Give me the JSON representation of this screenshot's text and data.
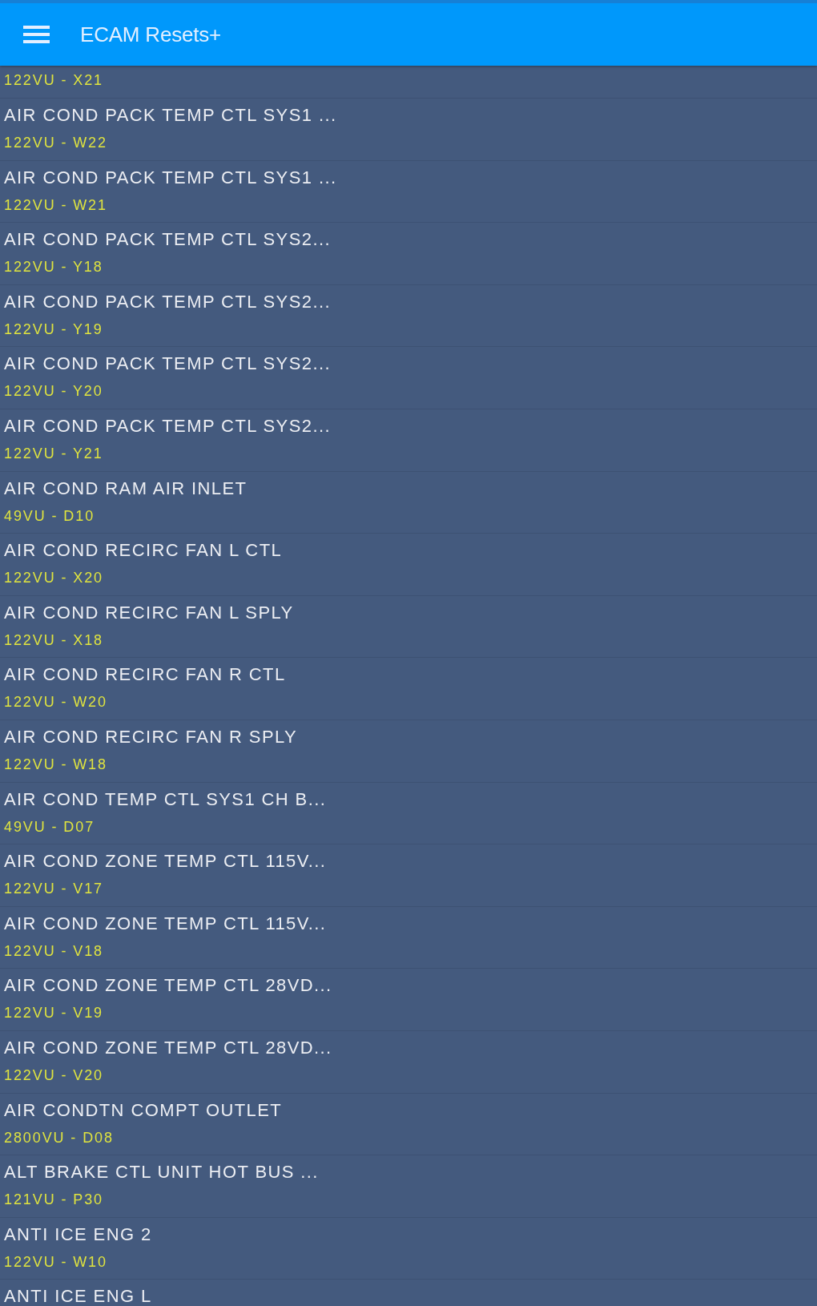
{
  "app_bar": {
    "title": "ECAM Resets+"
  },
  "resets": [
    {
      "code": "122VU - X21"
    },
    {
      "title": "AIR COND PACK TEMP CTL SYS1 ...",
      "code": "122VU - W22"
    },
    {
      "title": "AIR COND PACK TEMP CTL SYS1 ...",
      "code": "122VU - W21"
    },
    {
      "title": "AIR COND PACK TEMP CTL SYS2...",
      "code": "122VU - Y18"
    },
    {
      "title": "AIR COND PACK TEMP CTL SYS2...",
      "code": "122VU - Y19"
    },
    {
      "title": "AIR COND PACK TEMP CTL SYS2...",
      "code": "122VU - Y20"
    },
    {
      "title": "AIR COND PACK TEMP CTL SYS2...",
      "code": "122VU - Y21"
    },
    {
      "title": "AIR COND RAM AIR INLET",
      "code": "49VU - D10"
    },
    {
      "title": "AIR COND RECIRC FAN L CTL",
      "code": "122VU - X20"
    },
    {
      "title": "AIR COND RECIRC FAN L SPLY",
      "code": "122VU - X18"
    },
    {
      "title": "AIR COND RECIRC FAN R CTL",
      "code": "122VU - W20"
    },
    {
      "title": "AIR COND RECIRC FAN R SPLY",
      "code": "122VU - W18"
    },
    {
      "title": "AIR COND TEMP CTL SYS1 CH B...",
      "code": "49VU - D07"
    },
    {
      "title": "AIR COND ZONE TEMP CTL 115V...",
      "code": "122VU - V17"
    },
    {
      "title": "AIR COND ZONE TEMP CTL 115V...",
      "code": "122VU - V18"
    },
    {
      "title": "AIR COND ZONE TEMP CTL 28VD...",
      "code": "122VU - V19"
    },
    {
      "title": "AIR COND ZONE TEMP CTL 28VD...",
      "code": "122VU - V20"
    },
    {
      "title": "AIR CONDTN COMPT OUTLET",
      "code": "2800VU - D08"
    },
    {
      "title": "ALT BRAKE CTL UNIT HOT BUS ...",
      "code": "121VU - P30"
    },
    {
      "title": "ANTI ICE ENG 2",
      "code": "122VU - W10"
    },
    {
      "title": "ANTI ICE ENG L"
    }
  ]
}
